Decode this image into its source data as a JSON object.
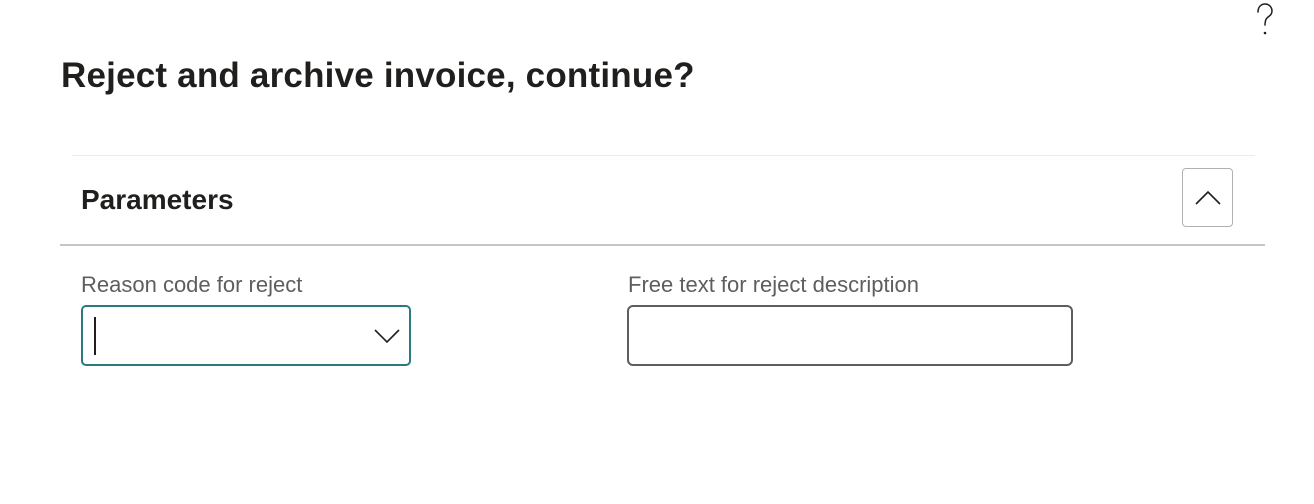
{
  "dialog": {
    "title": "Reject and archive invoice, continue?",
    "help_icon": "question-mark-icon"
  },
  "parameters_section": {
    "title": "Parameters",
    "collapse_icon": "chevron-up-icon",
    "expanded": true
  },
  "fields": {
    "reason_code": {
      "label": "Reason code for reject",
      "value": "",
      "dropdown_icon": "chevron-down-icon",
      "focused": true
    },
    "free_text": {
      "label": "Free text for reject description",
      "value": ""
    }
  },
  "colors": {
    "focus_border": "#2b7a80",
    "field_border": "#605e5c",
    "label_text": "#605e5c",
    "title_text": "#201f1e",
    "divider": "#c8c6c4"
  }
}
